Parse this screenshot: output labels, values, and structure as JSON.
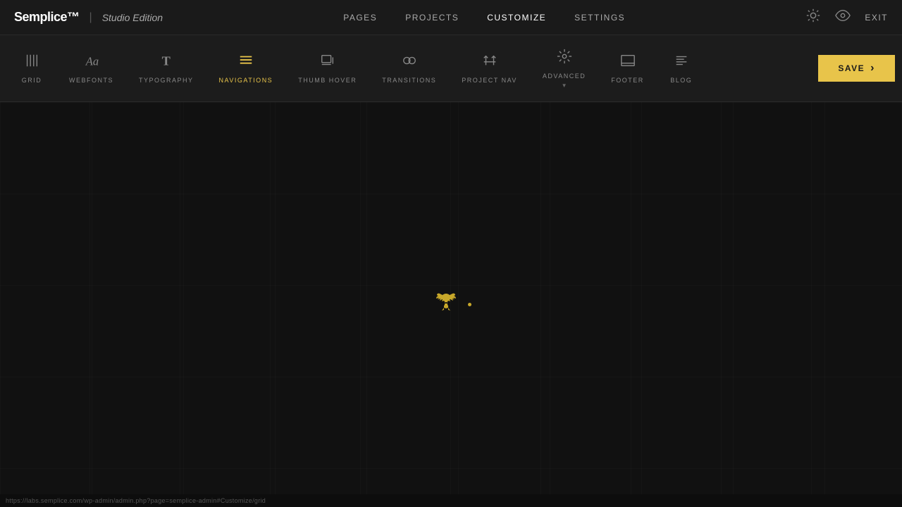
{
  "logo": {
    "brand": "Semplice™",
    "edition": "Studio Edition"
  },
  "topnav": {
    "items": [
      {
        "label": "PAGES",
        "active": false
      },
      {
        "label": "PROJECTS",
        "active": false
      },
      {
        "label": "CUSTOMIZE",
        "active": true
      },
      {
        "label": "SETTINGS",
        "active": false
      }
    ],
    "exit_label": "EXIT"
  },
  "toolbar": {
    "items": [
      {
        "id": "grid",
        "label": "GRID",
        "icon": "grid",
        "active": false
      },
      {
        "id": "webfonts",
        "label": "WEBFONTS",
        "icon": "font-a",
        "active": false
      },
      {
        "id": "typography",
        "label": "TYPOGRAPHY",
        "icon": "typography-t",
        "active": false
      },
      {
        "id": "navigations",
        "label": "NAVIGATIONS",
        "icon": "nav-lines",
        "active": true
      },
      {
        "id": "thumb-hover",
        "label": "THUMB HOVER",
        "icon": "thumb-hover",
        "active": false
      },
      {
        "id": "transitions",
        "label": "TRANSITIONS",
        "icon": "transitions",
        "active": false
      },
      {
        "id": "project-nav",
        "label": "PROJECT NAV",
        "icon": "project-nav",
        "active": false
      },
      {
        "id": "advanced",
        "label": "ADVANCED",
        "icon": "advanced",
        "active": false
      },
      {
        "id": "footer",
        "label": "FOOTER",
        "icon": "footer",
        "active": false
      },
      {
        "id": "blog",
        "label": "BLOG",
        "icon": "blog",
        "active": false
      }
    ],
    "save_label": "SAVE"
  },
  "status_bar": {
    "url": "https://labs.semplice.com/wp-admin/admin.php?page=semplice-admin#Customize/grid"
  },
  "icons": {
    "sun": "☀",
    "eye": "👁",
    "exit": "EXIT"
  }
}
